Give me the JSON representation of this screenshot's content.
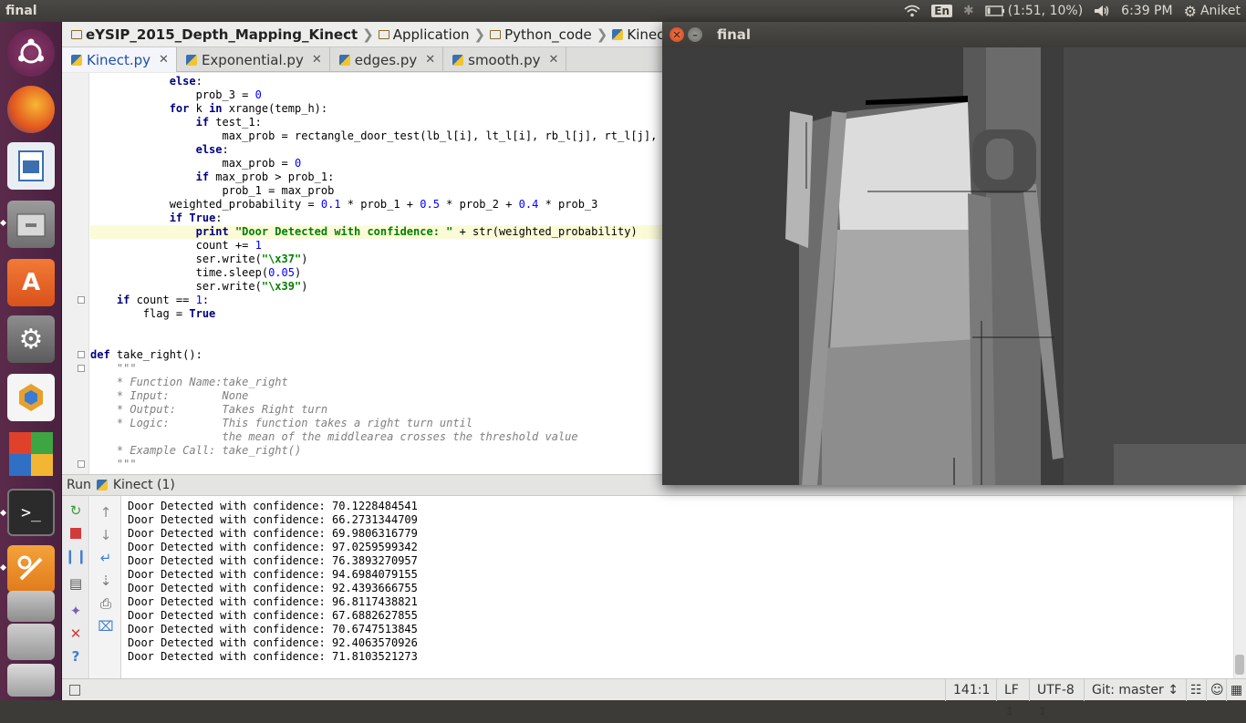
{
  "topbar": {
    "app_title": "final",
    "keyboard": "En",
    "battery": "(1:51, 10%)",
    "clock": "6:39 PM",
    "user": "Aniket"
  },
  "breadcrumb": [
    "eYSIP_2015_Depth_Mapping_Kinect",
    "Application",
    "Python_code",
    "Kinect.py"
  ],
  "tabs": [
    {
      "label": "Kinect.py",
      "active": true
    },
    {
      "label": "Exponential.py",
      "active": false
    },
    {
      "label": "edges.py",
      "active": false
    },
    {
      "label": "smooth.py",
      "active": false
    }
  ],
  "code_lines": [
    "            else:",
    "                prob_3 = 0",
    "            for k in xrange(temp_h):",
    "                if test_1:",
    "                    max_prob = rectangle_door_test(lb_l[i], lt_l[i], rb_l[j], rt_l[j],",
    "                else:",
    "                    max_prob = 0",
    "                if max_prob > prob_1:",
    "                    prob_1 = max_prob",
    "            weighted_probability = 0.1 * prob_1 + 0.5 * prob_2 + 0.4 * prob_3",
    "            if True:",
    "                print \"Door Detected with confidence: \" + str(weighted_probability)",
    "                count += 1",
    "                ser.write(\"\\x37\")",
    "                time.sleep(0.05)",
    "                ser.write(\"\\x39\")",
    "    if count == 1:",
    "        flag = True",
    "",
    "",
    "def take_right():",
    "    \"\"\"",
    "    * Function Name:take_right",
    "    * Input:        None",
    "    * Output:       Takes Right turn",
    "    * Logic:        This function takes a right turn until",
    "                    the mean of the middlearea crosses the threshold value",
    "    * Example Call: take_right()",
    "    \"\"\""
  ],
  "run_panel": {
    "run_label": "Run",
    "config_label": "Kinect (1)"
  },
  "console_lines": [
    "Door Detected with confidence: 70.1228484541",
    "Door Detected with confidence: 66.2731344709",
    "Door Detected with confidence: 69.9806316779",
    "Door Detected with confidence: 97.0259599342",
    "Door Detected with confidence: 76.3893270957",
    "Door Detected with confidence: 94.6984079155",
    "Door Detected with confidence: 92.4393666755",
    "Door Detected with confidence: 96.8117438821",
    "Door Detected with confidence: 67.6882627855",
    "Door Detected with confidence: 70.6747513845",
    "Door Detected with confidence: 92.4063570926",
    "Door Detected with confidence: 71.8103521273"
  ],
  "statusbar": {
    "position": "141:1",
    "line_sep": "LF ↕",
    "encoding": "UTF-8 ↕",
    "vcs": "Git: master ↕"
  },
  "image_window": {
    "title": "final"
  }
}
